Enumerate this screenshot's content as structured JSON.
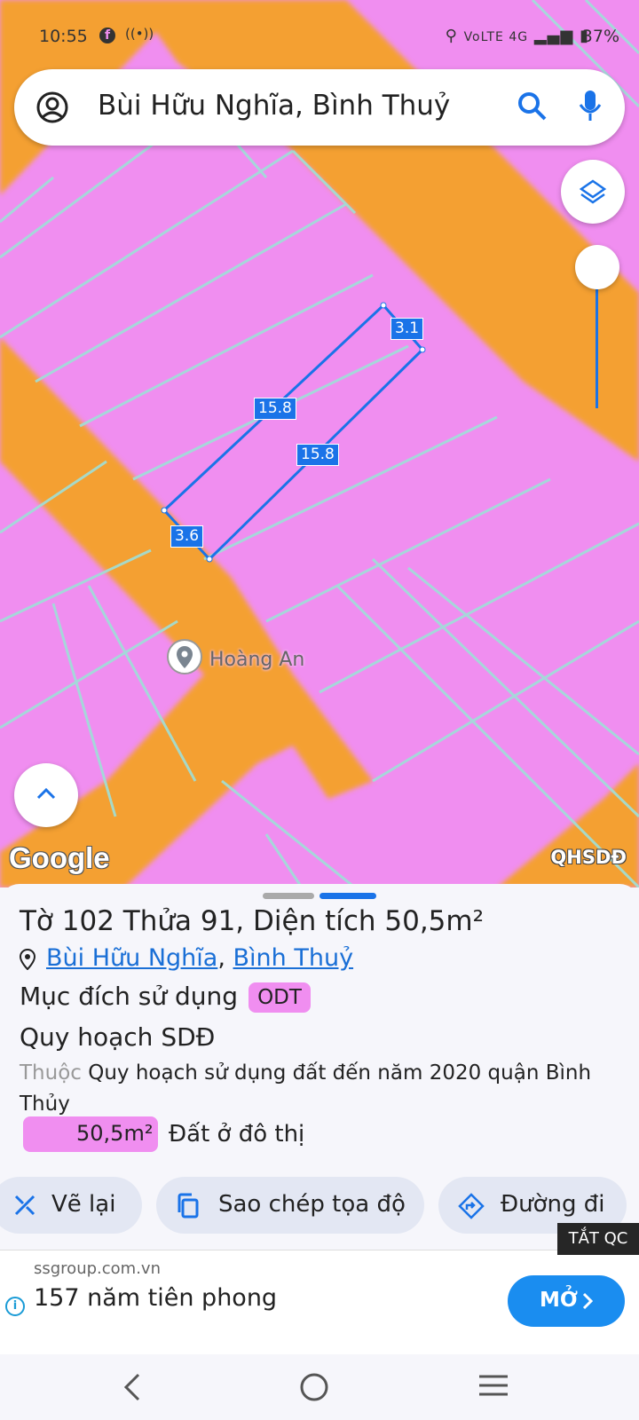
{
  "status_bar": {
    "time": "10:55",
    "network_icons": "VoLTE 4G",
    "battery": "37%"
  },
  "search": {
    "query": "Bùi Hữu Nghĩa, Bình Thuỷ"
  },
  "map": {
    "colors": {
      "land": "#f08ef0",
      "road": "#f4a030",
      "parcel_line": "#9fe0d8",
      "highlight": "#1a73e8"
    },
    "dimensions": [
      "3.1",
      "15.8",
      "15.8",
      "3.6"
    ],
    "poi_label": "Hoàng An",
    "attribution": "Google",
    "layer_badge": "QHSDĐ"
  },
  "sheet": {
    "title": "Tờ 102 Thửa 91, Diện tích 50,5m²",
    "address_street": "Bùi Hữu Nghĩa",
    "address_separator": ",",
    "address_district": "Bình Thuỷ",
    "purpose_label": "Mục đích sử dụng",
    "purpose_code": "ODT",
    "plan_heading": "Quy hoạch SDĐ",
    "belongs_prefix": "Thuộc",
    "belongs_text": "Quy hoạch sử dụng đất đến năm 2020 quận Bình Thủy",
    "area_value": "50,5m²",
    "area_type": "Đất ở đô thị"
  },
  "actions": {
    "redraw": "Vẽ lại",
    "copy_coords": "Sao chép tọa độ",
    "directions": "Đường đi"
  },
  "ad_off_label": "TẮT QC",
  "ad": {
    "domain": "ssgroup.com.vn",
    "headline": "157 năm tiên phong",
    "button": "MỞ"
  }
}
